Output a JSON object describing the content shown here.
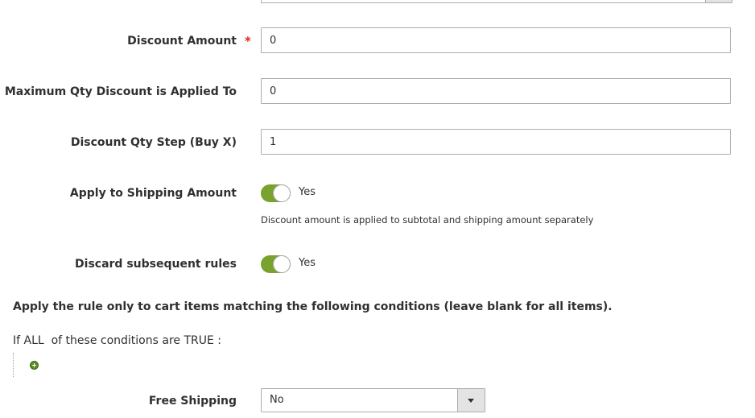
{
  "fields": {
    "discount_amount": {
      "label": "Discount Amount",
      "required_mark": "*",
      "value": "0"
    },
    "max_qty": {
      "label": "Maximum Qty Discount is Applied To",
      "value": "0"
    },
    "qty_step": {
      "label": "Discount Qty Step (Buy X)",
      "value": "1"
    },
    "apply_shipping": {
      "label": "Apply to Shipping Amount",
      "state": "Yes",
      "checked": true,
      "note": "Discount amount is applied to subtotal and shipping amount separately"
    },
    "discard_rules": {
      "label": "Discard subsequent rules",
      "state": "Yes",
      "checked": true
    }
  },
  "conditions": {
    "title": "Apply the rule only to cart items matching the following conditions (leave blank for all items).",
    "prefix": "If",
    "aggregator": "ALL",
    "middle": "of these conditions are",
    "value": "TRUE",
    "suffix": ":"
  },
  "free_shipping": {
    "label": "Free Shipping",
    "selected": "No"
  },
  "colors": {
    "toggle_on": "#79a22e",
    "required": "#e22626",
    "add_icon": "#5c8a2b"
  },
  "icons": {
    "add_condition": "plus-circle-icon",
    "dropdown": "chevron-down-icon"
  }
}
